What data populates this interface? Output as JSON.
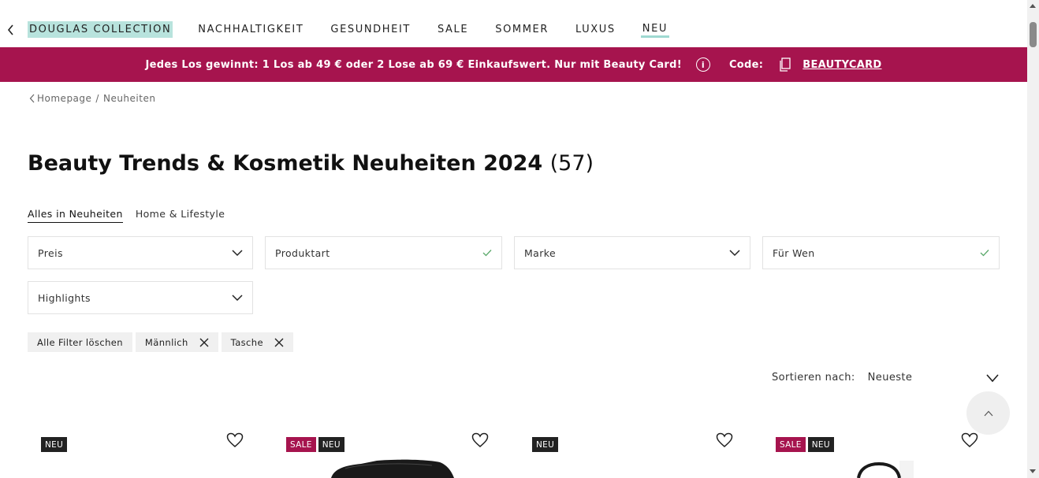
{
  "nav": {
    "items": [
      {
        "label": "DOUGLAS COLLECTION",
        "style": "highlight"
      },
      {
        "label": "NACHHALTIGKEIT",
        "style": ""
      },
      {
        "label": "GESUNDHEIT",
        "style": ""
      },
      {
        "label": "SALE",
        "style": ""
      },
      {
        "label": "SOMMER",
        "style": ""
      },
      {
        "label": "LUXUS",
        "style": ""
      },
      {
        "label": "NEU",
        "style": "active"
      }
    ]
  },
  "promo": {
    "text": "Jedes Los gewinnt: 1 Los ab 49 € oder 2 Lose ab 69 € Einkaufswert. Nur mit Beauty Card!",
    "info_symbol": "i",
    "code_label": "Code:",
    "code": "BEAUTYCARD",
    "bg_color": "#a6144e"
  },
  "breadcrumb": {
    "home": "Homepage",
    "separator": "/",
    "current": "Neuheiten"
  },
  "page": {
    "title": "Beauty Trends & Kosmetik Neuheiten 2024",
    "count": "(57)"
  },
  "tabs": [
    {
      "label": "Alles in Neuheiten",
      "active": true
    },
    {
      "label": "Home & Lifestyle",
      "active": false
    }
  ],
  "filters": {
    "preis": {
      "label": "Preis",
      "state": "dropdown"
    },
    "produktart": {
      "label": "Produktart",
      "state": "checked"
    },
    "marke": {
      "label": "Marke",
      "state": "dropdown"
    },
    "fuer_wen": {
      "label": "Für Wen",
      "state": "checked"
    },
    "highlights": {
      "label": "Highlights",
      "state": "dropdown"
    }
  },
  "chips": {
    "clear_all": "Alle Filter löschen",
    "active": [
      {
        "label": "Männlich"
      },
      {
        "label": "Tasche"
      }
    ]
  },
  "sort": {
    "label": "Sortieren nach:",
    "value": "Neueste"
  },
  "products": [
    {
      "badges": [
        "NEU"
      ],
      "image": "none"
    },
    {
      "badges": [
        "SALE",
        "NEU"
      ],
      "image": "black-bag"
    },
    {
      "badges": [
        "NEU"
      ],
      "image": "none"
    },
    {
      "badges": [
        "SALE",
        "NEU"
      ],
      "image": "black-handbag"
    }
  ],
  "colors": {
    "accent_mint": "#b8e3dd",
    "sale_badge": "#a6144e",
    "neu_badge": "#222222"
  }
}
